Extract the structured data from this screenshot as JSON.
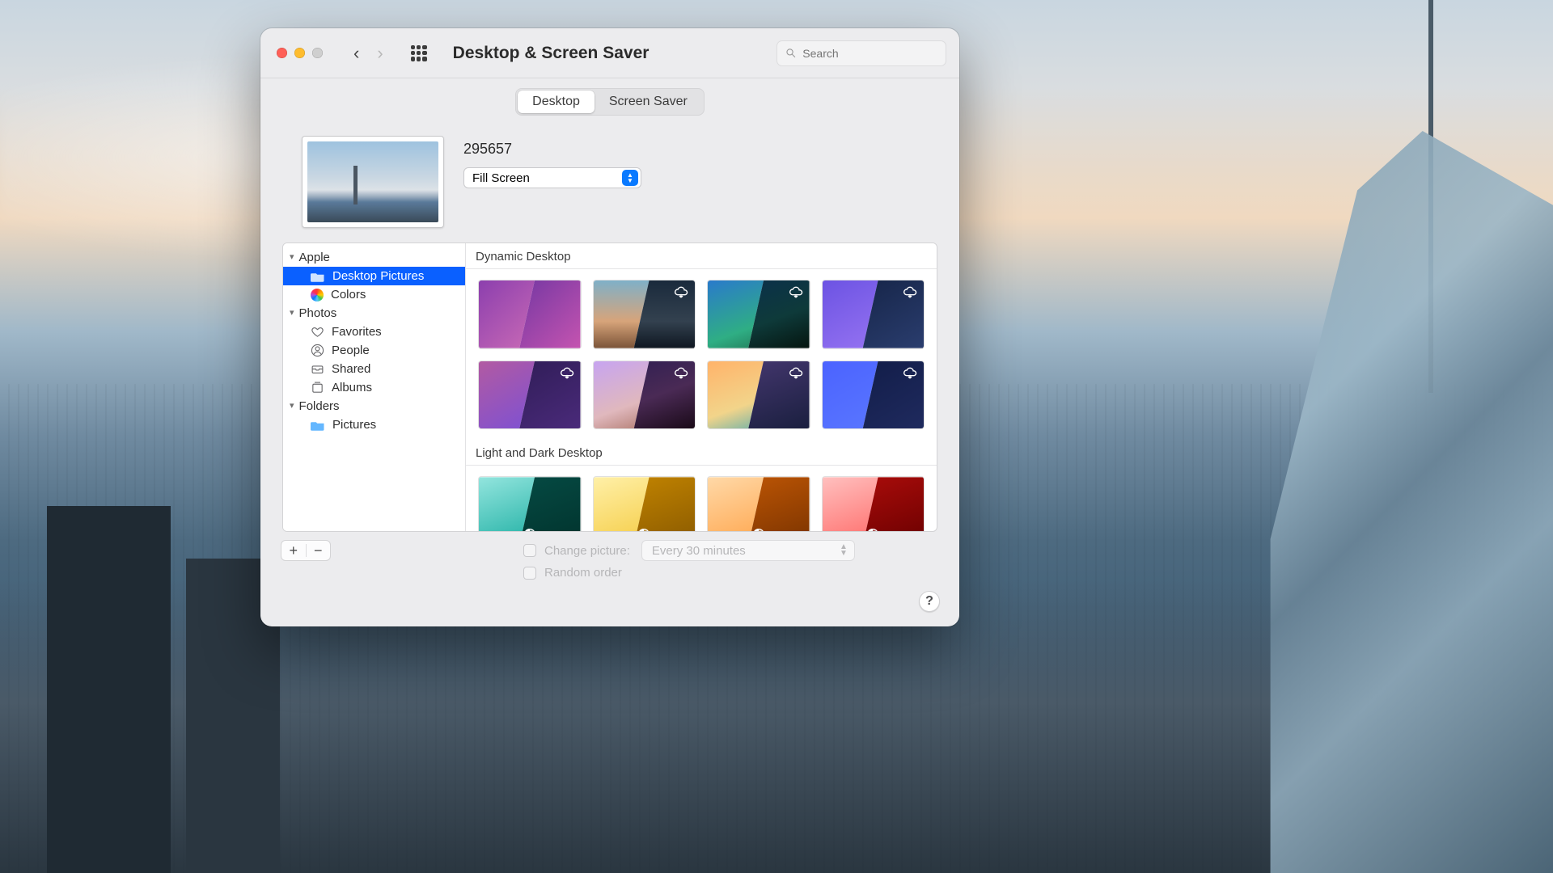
{
  "window": {
    "title": "Desktop & Screen Saver"
  },
  "search": {
    "placeholder": "Search"
  },
  "tabs": {
    "desktop": "Desktop",
    "screensaver": "Screen Saver",
    "active": "desktop"
  },
  "current": {
    "name": "295657",
    "fit": "Fill Screen"
  },
  "sidebar": {
    "groups": [
      {
        "label": "Apple",
        "items": [
          {
            "label": "Desktop Pictures",
            "icon": "folder",
            "selected": true
          },
          {
            "label": "Colors",
            "icon": "colors"
          }
        ]
      },
      {
        "label": "Photos",
        "items": [
          {
            "label": "Favorites",
            "icon": "heart"
          },
          {
            "label": "People",
            "icon": "person"
          },
          {
            "label": "Shared",
            "icon": "box"
          },
          {
            "label": "Albums",
            "icon": "albums"
          }
        ]
      },
      {
        "label": "Folders",
        "items": [
          {
            "label": "Pictures",
            "icon": "folder"
          }
        ]
      }
    ],
    "footer": {
      "add": "+",
      "remove": "−"
    }
  },
  "gallery": {
    "sections": [
      {
        "label": "Dynamic Desktop",
        "thumbs": [
          "dd1",
          "dd2",
          "dd3",
          "dd4",
          "dd5",
          "dd6",
          "dd7",
          "dd8"
        ],
        "cloud": [
          false,
          true,
          true,
          true,
          true,
          true,
          true,
          true
        ]
      },
      {
        "label": "Light and Dark Desktop",
        "thumbs": [
          "ld1",
          "ld2",
          "ld3",
          "ld4"
        ]
      }
    ]
  },
  "options": {
    "change_label": "Change picture:",
    "interval": "Every 30 minutes",
    "random_label": "Random order"
  },
  "help": "?"
}
